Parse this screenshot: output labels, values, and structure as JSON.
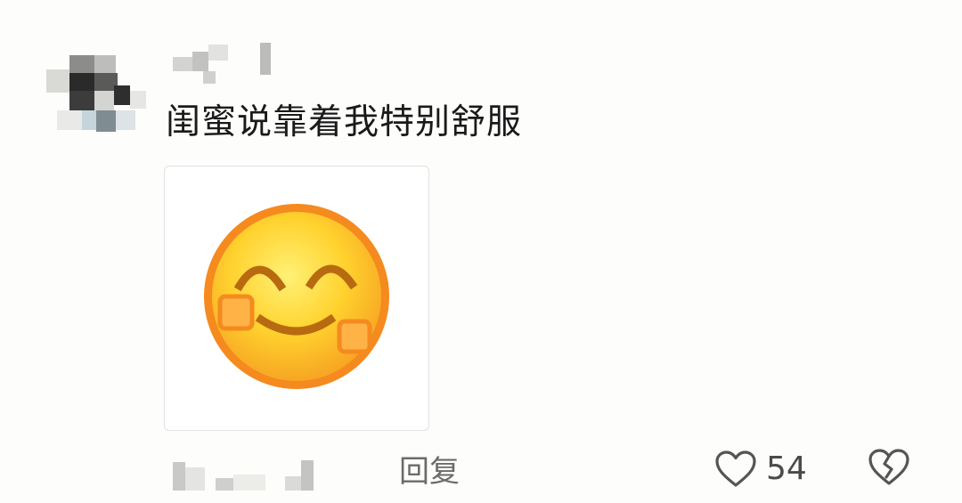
{
  "comment": {
    "text": "闺蜜说靠着我特别舒服",
    "image_icon": "smiling-blush-emoji-icon"
  },
  "actions": {
    "reply_label": "回复",
    "like_icon": "heart-outline-icon",
    "like_count": "54",
    "dislike_icon": "broken-heart-icon"
  },
  "colors": {
    "text": "#1a1a1a",
    "secondary_text": "#6b6b6b",
    "icon_gray": "#555555",
    "emoji_yellow": "#ffd22e",
    "emoji_orange": "#f58a1f"
  }
}
